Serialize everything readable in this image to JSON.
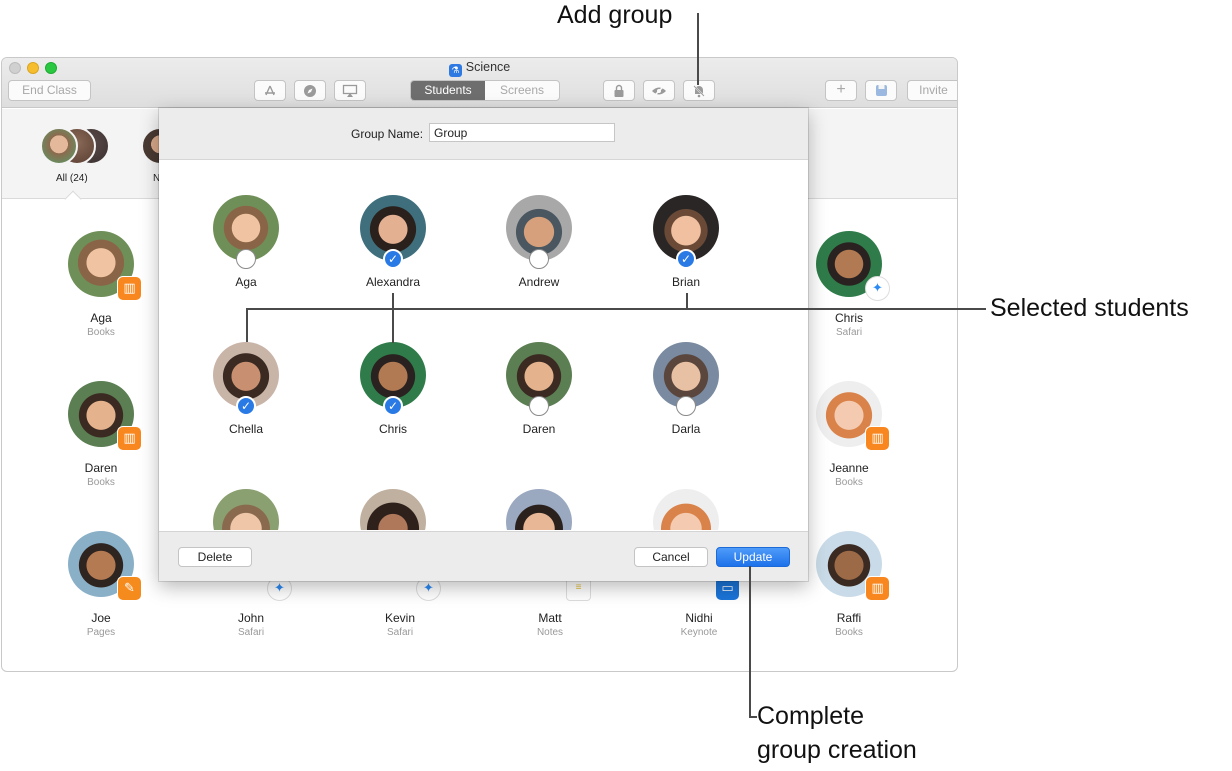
{
  "window": {
    "title": "Science",
    "app_icon": "microscope-icon",
    "toolbar": {
      "end_class": "End Class",
      "tabs": [
        "Students",
        "Screens"
      ],
      "active_tab": "Students",
      "invite": "Invite",
      "icons": [
        "app-store-icon",
        "safari-compass-icon",
        "airplay-icon",
        "lock-icon",
        "hide-eye-icon",
        "mute-icon",
        "add-group-icon",
        "save-icon"
      ]
    },
    "groups": [
      {
        "label": "All (24)"
      },
      {
        "label": "N"
      }
    ],
    "students": [
      {
        "name": "Aga",
        "app": "Books",
        "badge": "#f7871e"
      },
      {
        "name": "Chris",
        "app": "Safari",
        "badge": "#2b8af4"
      },
      {
        "name": "Daren",
        "app": "Books",
        "badge": "#f7871e"
      },
      {
        "name": "Jeanne",
        "app": "Books",
        "badge": "#f7871e"
      },
      {
        "name": "Joe",
        "app": "Pages",
        "badge": "#f58a1d"
      },
      {
        "name": "John",
        "app": "Safari",
        "badge": "#2b8af4"
      },
      {
        "name": "Kevin",
        "app": "Safari",
        "badge": "#2b8af4"
      },
      {
        "name": "Matt",
        "app": "Notes",
        "badge": "#f3d54a"
      },
      {
        "name": "Nidhi",
        "app": "Keynote",
        "badge": "#1b75d9"
      },
      {
        "name": "Raffi",
        "app": "Books",
        "badge": "#f7871e"
      }
    ]
  },
  "sheet": {
    "group_name_label": "Group Name:",
    "group_name_value": "Group",
    "students": [
      {
        "name": "Aga",
        "selected": false
      },
      {
        "name": "Alexandra",
        "selected": true
      },
      {
        "name": "Andrew",
        "selected": false
      },
      {
        "name": "Brian",
        "selected": true
      },
      {
        "name": "Chella",
        "selected": true
      },
      {
        "name": "Chris",
        "selected": true
      },
      {
        "name": "Daren",
        "selected": false
      },
      {
        "name": "Darla",
        "selected": false
      }
    ],
    "delete": "Delete",
    "cancel": "Cancel",
    "update": "Update"
  },
  "callouts": {
    "add_group": "Add group",
    "selected_students": "Selected students",
    "complete_line1": "Complete",
    "complete_line2": "group creation"
  },
  "colors": {
    "accent": "#2a7ae6",
    "books_badge": "#f7871e",
    "safari_badge": "#2b8af4"
  }
}
